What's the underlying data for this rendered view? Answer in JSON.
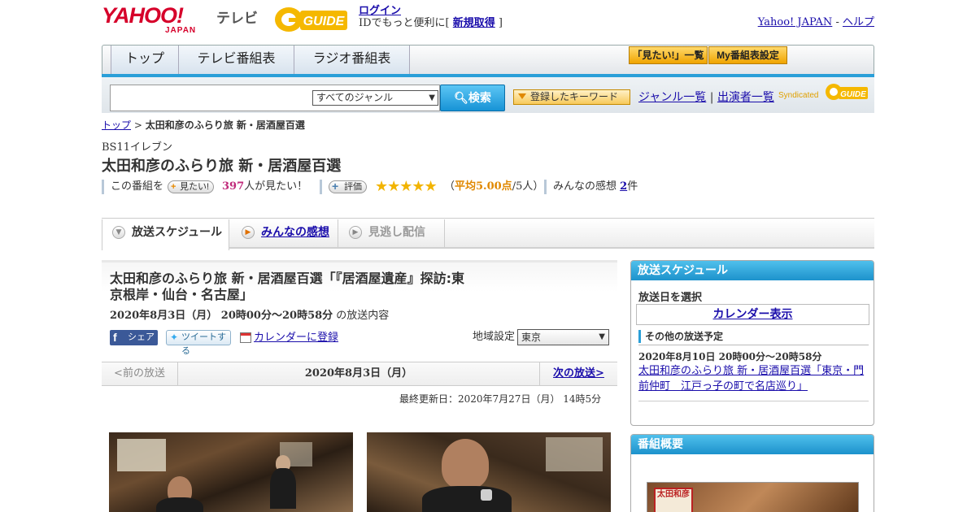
{
  "header": {
    "logo_text": "YAHOO!",
    "logo_sub": "JAPAN",
    "service_name": "テレビ",
    "gguide_logo": "G-GUIDE",
    "login_label": "ログイン",
    "login_message_prefix": "IDでもっと便利に[ ",
    "register_label": "新規取得",
    "login_message_suffix": " ]",
    "yahoo_japan_link": "Yahoo! JAPAN",
    "separator": " - ",
    "help_link": "ヘルプ"
  },
  "nav": {
    "tabs": [
      {
        "label": "トップ"
      },
      {
        "label": "テレビ番組表"
      },
      {
        "label": "ラジオ番組表"
      }
    ],
    "want_list_button": "「見たい!」一覧",
    "my_program_button": "My番組表設定"
  },
  "search": {
    "input_value": "",
    "genre_selected": "すべてのジャンル",
    "search_button": "検索",
    "keyword_button": "登録したキーワード",
    "genre_list_link": "ジャンル一覧",
    "divider": " | ",
    "performer_list_link": "出演者一覧",
    "syndicated_label": "Syndicated"
  },
  "breadcrumb": {
    "home": "トップ",
    "sep": " > ",
    "current": "太田和彦のふらり旅 新・居酒屋百選"
  },
  "program": {
    "channel": "BS11イレブン",
    "title": "太田和彦のふらり旅 新・居酒屋百選",
    "this_program_label": "この番組を",
    "want_button": "見たい!",
    "want_count": "397",
    "want_suffix": "人が見たい！",
    "rating_button": "評価",
    "rating_stars": "★★★★★",
    "rating_open": "（",
    "rating_avg": "平均5.00点",
    "rating_people": "/5人）",
    "impressions_label": "みんなの感想 ",
    "impressions_count": "2",
    "impressions_suffix": "件"
  },
  "tabs": {
    "schedule": "放送スケジュール",
    "impressions": "みんなの感想",
    "missed": "見逃し配信"
  },
  "episode": {
    "title": "太田和彦のふらり旅 新・居酒屋百選「『居酒屋遺産』探訪:東京根岸・仙台・名古屋」",
    "datetime": "2020年8月3日（月） 20時00分～20時58分",
    "datetime_suffix": " の放送内容",
    "facebook_share": "シェア",
    "tweet": "ツイートする",
    "calendar_register": "カレンダーに登録",
    "region_label": "地域設定",
    "region_selected": "東京",
    "prev_broadcast": "<前の放送",
    "current_date": "2020年8月3日（月）",
    "next_broadcast": "次の放送>",
    "last_updated": "最終更新日：2020年7月27日（月） 14時5分"
  },
  "sidebar": {
    "schedule_heading": "放送スケジュール",
    "select_date_label": "放送日を選択",
    "calendar_link": "カレンダー表示",
    "other_heading": "その他の放送予定",
    "other_date": "2020年8月10日 20時00分～20時58分",
    "other_link": "太田和彦のふらり旅 新・居酒屋百選「東京・門前仲町　江戸っ子の町で名店巡り」",
    "overview_heading": "番組概要",
    "overview_sign_text": "太田和彦"
  },
  "colors": {
    "brand_red": "#d6002a",
    "accent_blue": "#2a9fd8",
    "link": "#1a0dab",
    "star": "#f2b400",
    "want_count": "#c0297a",
    "rating_avg": "#e08800"
  },
  "icons": [
    "search-icon",
    "facebook-icon",
    "twitter-icon",
    "calendar-icon",
    "chevron-down-icon",
    "play-icon"
  ]
}
